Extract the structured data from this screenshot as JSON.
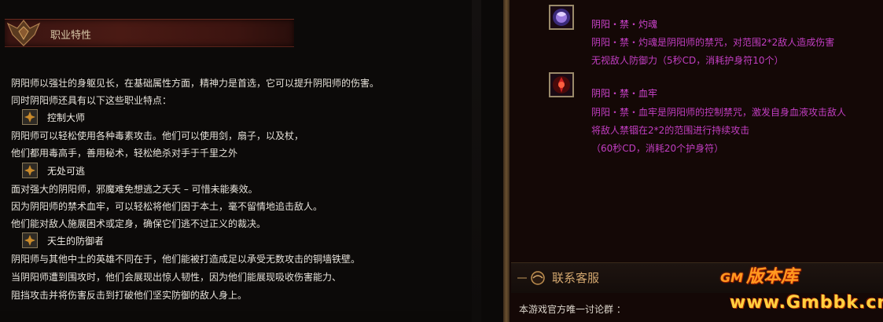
{
  "left": {
    "header_title": "职业特性",
    "intro_lines": [
      "阴阳师以强壮的身躯见长，在基础属性方面，精神力是首选，它可以提升阴阳师的伤害。",
      "同时阴阳师还具有以下这些职业特点："
    ],
    "traits": [
      {
        "title": "控制大师",
        "lines": [
          "阴阳师可以轻松使用各种毒素攻击。他们可以使用剑，扇子，以及杖，",
          "他们都用毒高手，善用秘术，轻松绝杀对手于千里之外"
        ]
      },
      {
        "title": "无处可逃",
        "lines": [
          "面对强大的阴阳师，邪魔难免想逃之夭夭  –  可惜未能奏效。",
          "因为阴阳师的禁术血牢，可以轻松将他们困于本土，毫不留情地追击敌人。",
          "他们能对敌人施展困术或定身，确保它们逃不过正义的裁决。"
        ]
      },
      {
        "title": "天生的防御者",
        "lines": [
          "阴阳师与其他中土的英雄不同在于，他们能被打造成足以承受无数攻击的铜墙铁壁。",
          "当阴阳师遭到围攻时，他们会展现出惊人韧性，因为他们能展现吸收伤害能力、",
          "阻挡攻击并将伤害反击到打破他们坚实防御的敌人身上。"
        ]
      }
    ]
  },
  "right": {
    "skills": [
      {
        "icon": "spirit-orb-icon",
        "name": "阴阳・禁・灼魂",
        "lines": [
          "阴阳・禁・灼魂是阴阳师的禁咒，对范围2*2敌人造成伤害",
          "无视敌人防御力（5秒CD，消耗护身符10个）"
        ]
      },
      {
        "icon": "blood-prison-icon",
        "name": "阴阳・禁・血牢",
        "lines": [
          "阴阳・禁・血牢是阴阳师的控制禁咒，激发自身血液攻击敌人",
          "将敌人禁锢在2*2的范围进行持续攻击",
          "（60秒CD，消耗20个护身符）"
        ]
      }
    ],
    "contact_title": "联系客服",
    "contact_text": "本游戏官方唯一讨论群  ：",
    "watermark_top": "版本库",
    "watermark_brand": "GM",
    "watermark_url": "www.Gmbbk.cn"
  }
}
